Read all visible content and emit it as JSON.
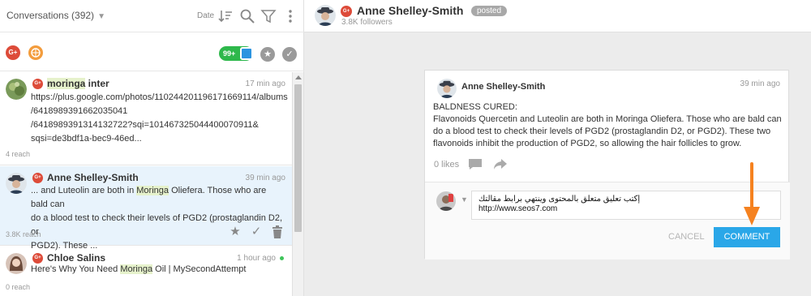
{
  "left": {
    "title": "Conversations (392)",
    "sort_label": "Date",
    "badge_count": "99+",
    "conversations": [
      {
        "name": "moringa",
        "name_rest": " inter",
        "time": "17 min ago",
        "body_lines": [
          "https://plus.google.com/photos/110244201196171669114/albums",
          "/6418989391662035041",
          "/6418989391314132722?sqi=101467325044400070911&",
          "sqsi=de3bdf1a-bec9-46ed..."
        ],
        "reach": "4 reach"
      },
      {
        "name": "Anne Shelley-Smith",
        "time": "39 min ago",
        "body_1a": "... and Luteolin are both in ",
        "body_1b": "Moringa",
        "body_1c": " Oliefera. Those who are bald can",
        "body_2": "do a blood test to check their levels of PGD2 (prostaglandin D2, or",
        "body_3": "PGD2). These ...",
        "reach": "3.8K reach"
      },
      {
        "name": "Chloe Salins",
        "time": "1 hour ago",
        "body_1a": "Here's Why You Need ",
        "body_1b": "Moringa",
        "body_1c": " Oil | MySecondAttempt",
        "reach": "0 reach"
      }
    ]
  },
  "right": {
    "header": {
      "name": "Anne Shelley-Smith",
      "status": "posted",
      "followers": "3.8K followers"
    },
    "card": {
      "author": "Anne Shelley-Smith",
      "time": "39 min ago",
      "heading": "BALDNESS CURED:",
      "text": "Flavonoids Quercetin and Luteolin are both in Moringa Oliefera. Those who are bald can do a blood test to check their levels of PGD2 (prostaglandin D2, or PGD2). These two flavonoids inhibit the production of PGD2, so allowing the hair follicles to grow.",
      "likes": "0 likes"
    },
    "comment": {
      "line1": "إكتب تعليق متعلق بالمحتوى وينتهي برابط مقالتك",
      "line2": "http://www.seos7.com",
      "cancel_label": "CANCEL",
      "submit_label": "COMMENT"
    }
  },
  "colors": {
    "accent": "#2aa7e8",
    "gplus": "#dd4b39",
    "badge_green": "#2eb84b",
    "highlight": "#e6f2cc",
    "annotation_arrow": "#f58220"
  },
  "icons": [
    "chevron-down-icon",
    "sort-icon",
    "search-icon",
    "filter-icon",
    "more-vert-icon",
    "gplus-icon",
    "rss-icon",
    "star-icon",
    "check-icon",
    "trash-icon",
    "comment-icon",
    "share-icon"
  ]
}
